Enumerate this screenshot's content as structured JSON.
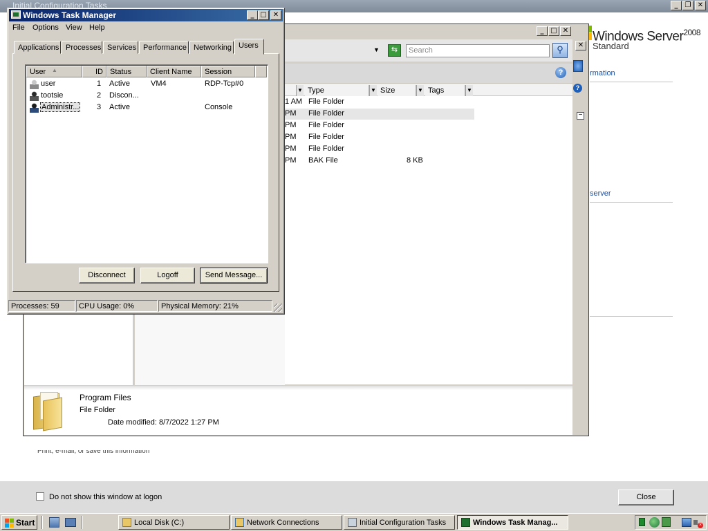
{
  "ict_window": {
    "title": "Initial Configuration Tasks",
    "logo_text": "Windows Server",
    "logo_version": "2008",
    "edition": "Standard",
    "frag_information": "rmation",
    "frag_server": "server",
    "frag_print": "Print, e-mail, or save this information",
    "dont_show_label": "Do not show this window at logon",
    "close_button": "Close",
    "caption_buttons": [
      "_",
      "❐",
      "✕"
    ]
  },
  "explorer": {
    "search_placeholder": "Search",
    "caption_buttons": [
      "_",
      "□",
      "✕"
    ],
    "columns": [
      "Type",
      "Size",
      "Tags"
    ],
    "rows": [
      {
        "time": "1 AM",
        "type": "File Folder",
        "size": ""
      },
      {
        "time": "PM",
        "type": "File Folder",
        "size": ""
      },
      {
        "time": "PM",
        "type": "File Folder",
        "size": ""
      },
      {
        "time": "PM",
        "type": "File Folder",
        "size": ""
      },
      {
        "time": "PM",
        "type": "File Folder",
        "size": ""
      },
      {
        "time": "PM",
        "type": "BAK File",
        "size": "8 KB"
      }
    ],
    "details": {
      "name": "Program Files",
      "type": "File Folder",
      "modified_label": "Date modified:",
      "modified_value": "8/7/2022 1:27 PM"
    }
  },
  "task_manager": {
    "title": "Windows Task Manager",
    "caption_buttons": [
      "_",
      "□",
      "✕"
    ],
    "menu": [
      "File",
      "Options",
      "View",
      "Help"
    ],
    "tabs": [
      "Applications",
      "Processes",
      "Services",
      "Performance",
      "Networking",
      "Users"
    ],
    "active_tab": "Users",
    "columns": [
      "User",
      "ID",
      "Status",
      "Client Name",
      "Session"
    ],
    "users": [
      {
        "user": "user",
        "id": "1",
        "status": "Active",
        "client": "VM4",
        "session": "RDP-Tcp#0",
        "icon": "user-icon"
      },
      {
        "user": "tootsie",
        "id": "2",
        "status": "Discon...",
        "client": "",
        "session": "",
        "icon": "disconnected-user-icon"
      },
      {
        "user": "Administr...",
        "id": "3",
        "status": "Active",
        "client": "",
        "session": "Console",
        "icon": "admin-user-icon"
      }
    ],
    "buttons": {
      "disconnect": "Disconnect",
      "logoff": "Logoff",
      "send_message": "Send Message..."
    },
    "status_bar": {
      "processes": "Processes: 59",
      "cpu": "CPU Usage: 0%",
      "memory": "Physical Memory: 21%"
    }
  },
  "taskbar": {
    "start": "Start",
    "tasks": [
      {
        "label": "Local Disk (C:)",
        "active": false
      },
      {
        "label": "Network Connections",
        "active": false
      },
      {
        "label": "Initial Configuration Tasks",
        "active": false
      },
      {
        "label": "Windows Task Manag...",
        "active": true
      }
    ]
  }
}
